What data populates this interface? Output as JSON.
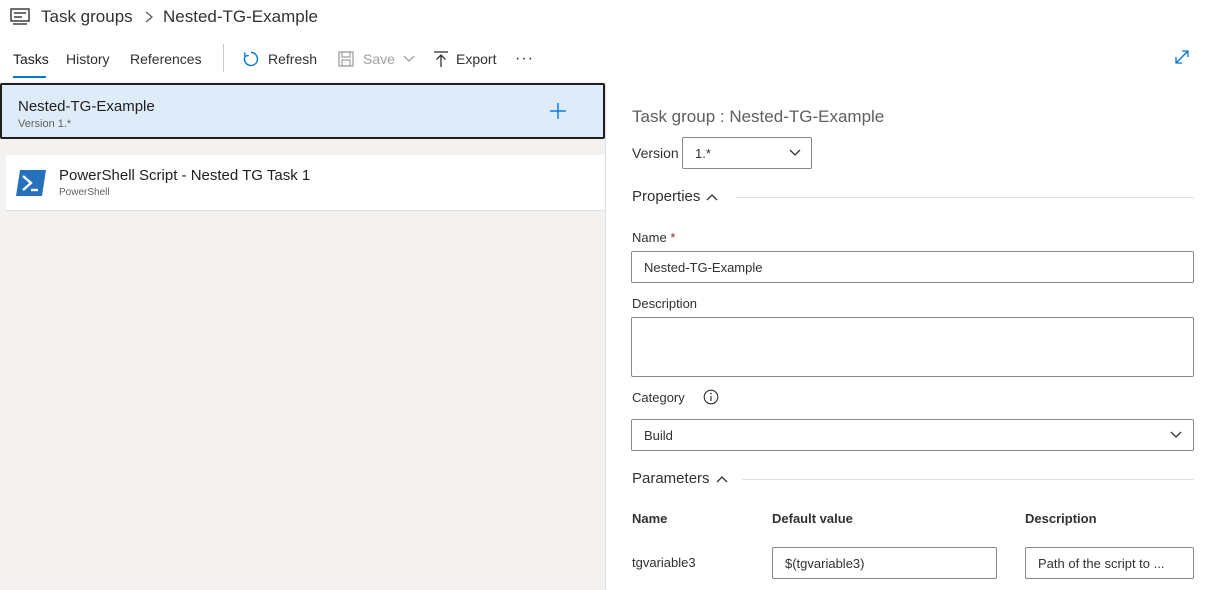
{
  "breadcrumb": {
    "root": "Task groups",
    "current": "Nested-TG-Example"
  },
  "tabs": [
    {
      "label": "Tasks",
      "active": true
    },
    {
      "label": "History",
      "active": false
    },
    {
      "label": "References",
      "active": false
    }
  ],
  "toolbar": {
    "refresh_label": "Refresh",
    "save_label": "Save",
    "export_label": "Export",
    "more_label": "···"
  },
  "task_group_row": {
    "name": "Nested-TG-Example",
    "version": "Version 1.*"
  },
  "tasks": [
    {
      "name": "PowerShell Script - Nested TG Task 1",
      "type": "PowerShell"
    }
  ],
  "details": {
    "title": "Task group : Nested-TG-Example",
    "version_label": "Version",
    "version_value": "1.*",
    "properties_label": "Properties",
    "name_label": "Name",
    "name_required": "*",
    "name_value": "Nested-TG-Example",
    "description_label": "Description",
    "description_value": "",
    "category_label": "Category",
    "category_value": "Build",
    "parameters_label": "Parameters",
    "param_headers": {
      "name": "Name",
      "default": "Default value",
      "description": "Description"
    },
    "parameters": [
      {
        "name": "tgvariable3",
        "default": "$(tgvariable3)",
        "description": "Path of the script to ..."
      }
    ]
  },
  "colors": {
    "accent": "#0078d4",
    "selected_row": "#deecf9",
    "pane_bg": "#f3f2f1",
    "powershell": "#2671be"
  }
}
